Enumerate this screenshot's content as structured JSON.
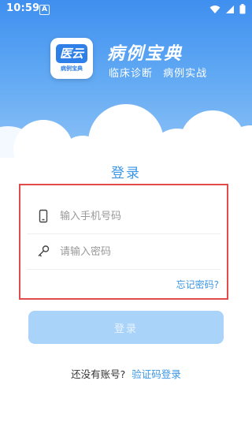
{
  "status_bar": {
    "time": "10:59",
    "notification_badge": "A",
    "icons": [
      "wifi-icon",
      "signal-icon",
      "battery-icon"
    ]
  },
  "header": {
    "logo_mark": "医云",
    "logo_caption": "病例宝典",
    "app_title": "病例宝典",
    "app_subtitle": "临床诊断 病例实战"
  },
  "login": {
    "title": "登录",
    "phone_placeholder": "输入手机号码",
    "phone_value": "",
    "password_placeholder": "请输入密码",
    "password_value": "",
    "forgot_label": "忘记密码?",
    "submit_label": "登录"
  },
  "register": {
    "question": "还没有账号?",
    "link_label": "验证码登录"
  },
  "colors": {
    "brand": "#3f8ff0",
    "accent_text": "#3a96e6",
    "button_disabled": "#a9d3f8",
    "highlight_border": "#e24b4b"
  }
}
